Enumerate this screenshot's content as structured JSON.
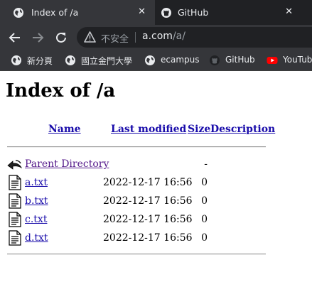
{
  "tabs": [
    {
      "title": "Index of /a",
      "active": true,
      "icon": "globe-icon"
    },
    {
      "title": "GitHub",
      "active": false,
      "icon": "github-icon"
    }
  ],
  "omnibox": {
    "security_label": "不安全",
    "url_host": "a.com",
    "url_path": "/a/"
  },
  "bookmarks": [
    {
      "label": "新分頁",
      "icon": "globe-icon"
    },
    {
      "label": "國立金門大學",
      "icon": "globe-icon"
    },
    {
      "label": "ecampus",
      "icon": "globe-icon"
    },
    {
      "label": "GitHub",
      "icon": "github-icon"
    },
    {
      "label": "YouTub",
      "icon": "youtube-icon"
    }
  ],
  "page": {
    "title": "Index of /a",
    "columns": {
      "name": "Name",
      "modified": "Last modified",
      "size": "Size",
      "description": "Description"
    },
    "parent": {
      "label": "Parent Directory",
      "size": "-",
      "icon": "back-arrow-icon"
    },
    "files": [
      {
        "name": "a.txt",
        "modified": "2022-12-17 16:56",
        "size": "0",
        "icon": "text-file-icon"
      },
      {
        "name": "b.txt",
        "modified": "2022-12-17 16:56",
        "size": "0",
        "icon": "text-file-icon"
      },
      {
        "name": "c.txt",
        "modified": "2022-12-17 16:56",
        "size": "0",
        "icon": "text-file-icon"
      },
      {
        "name": "d.txt",
        "modified": "2022-12-17 16:56",
        "size": "0",
        "icon": "text-file-icon"
      }
    ]
  },
  "colors": {
    "chrome_dark": "#202124",
    "chrome_mid": "#35363a",
    "link": "#1a0dab",
    "visited": "#551a8b"
  }
}
